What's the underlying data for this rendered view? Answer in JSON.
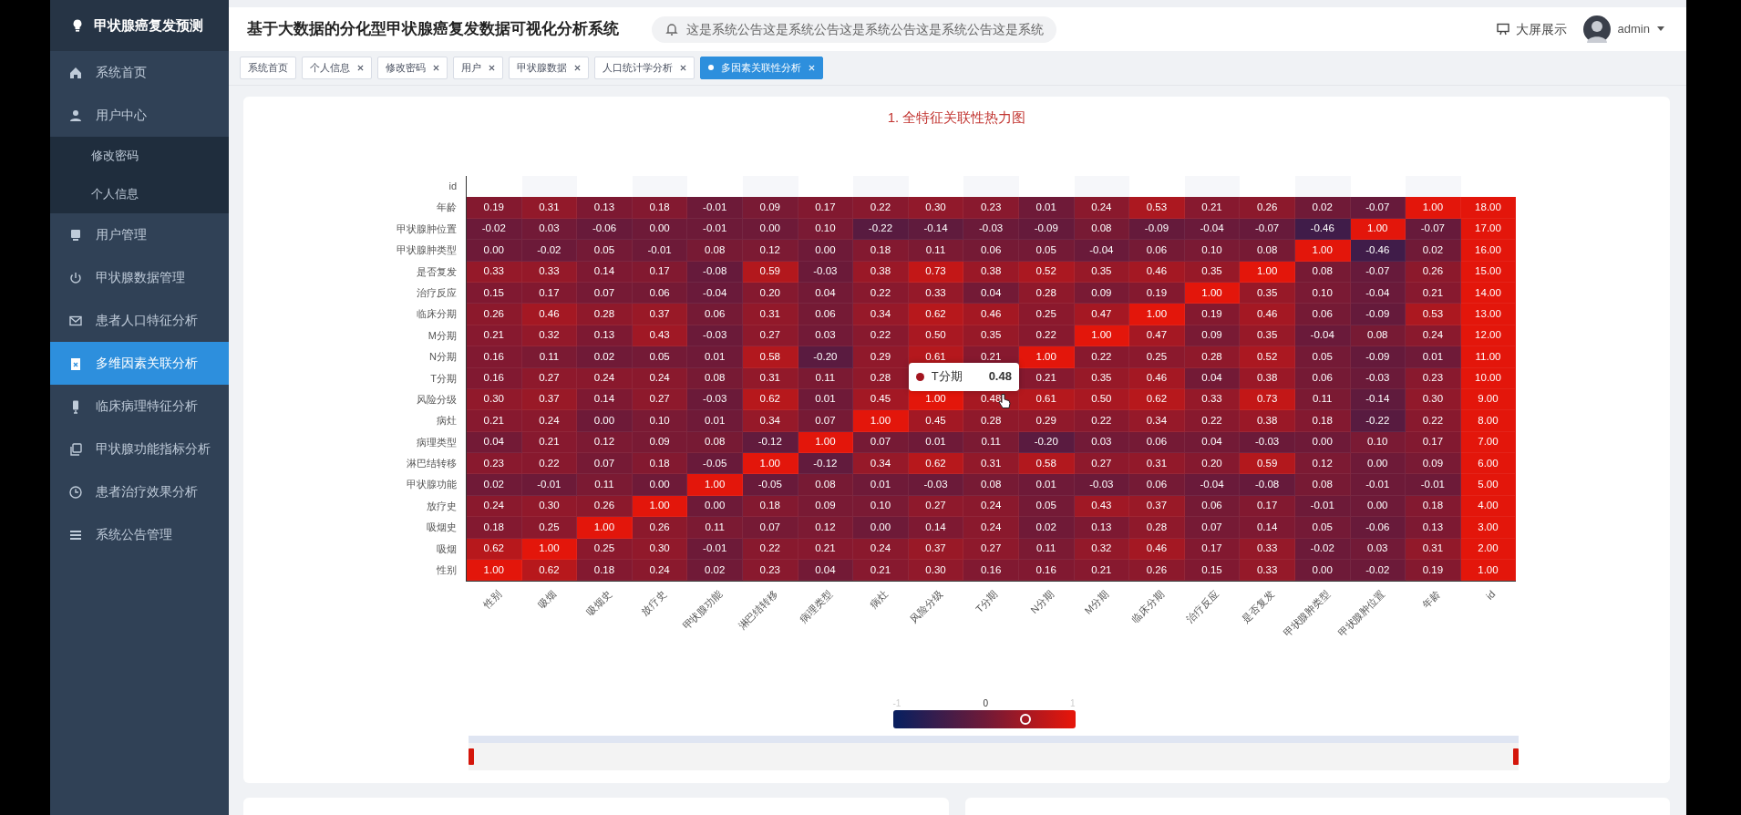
{
  "brand": {
    "title": "甲状腺癌复发预测"
  },
  "sidebar": {
    "items": [
      {
        "label": "系统首页",
        "selected": false
      },
      {
        "label": "用户中心",
        "selected": false,
        "expanded": true,
        "children": [
          {
            "label": "修改密码",
            "selected": false
          },
          {
            "label": "个人信息",
            "selected": false
          }
        ]
      },
      {
        "label": "用户管理",
        "selected": false
      },
      {
        "label": "甲状腺数据管理",
        "selected": false
      },
      {
        "label": "患者人口特征分析",
        "selected": false
      },
      {
        "label": "多维因素关联分析",
        "selected": true
      },
      {
        "label": "临床病理特征分析",
        "selected": false
      },
      {
        "label": "甲状腺功能指标分析",
        "selected": false
      },
      {
        "label": "患者治疗效果分析",
        "selected": false
      },
      {
        "label": "系统公告管理",
        "selected": false
      }
    ]
  },
  "header": {
    "title": "基于大数据的分化型甲状腺癌复发数据可视化分析系统",
    "notice": "这是系统公告这是系统公告这是系统公告这是系统公告这是系统",
    "big_screen": "大屏展示",
    "user": "admin"
  },
  "tabs": [
    {
      "label": "系统首页",
      "closable": false,
      "selected": false
    },
    {
      "label": "个人信息",
      "closable": true,
      "selected": false
    },
    {
      "label": "修改密码",
      "closable": true,
      "selected": false
    },
    {
      "label": "用户",
      "closable": true,
      "selected": false
    },
    {
      "label": "甲状腺数据",
      "closable": true,
      "selected": false
    },
    {
      "label": "人口统计学分析",
      "closable": true,
      "selected": false
    },
    {
      "label": "多因素关联性分析",
      "closable": true,
      "selected": true
    }
  ],
  "heatmap": {
    "title": "1. 全特征关联性热力图",
    "columns": [
      "性别",
      "吸烟",
      "吸烟史",
      "放疗史",
      "甲状腺功能",
      "淋巴结转移",
      "病理类型",
      "病灶",
      "风险分级",
      "T分期",
      "N分期",
      "M分期",
      "临床分期",
      "治疗反应",
      "是否复发",
      "甲状腺肿类型",
      "甲状腺肿位置",
      "年龄",
      "id"
    ],
    "rows": [
      {
        "label": "id"
      },
      {
        "label": "年龄",
        "cells": [
          "0.19",
          "0.31",
          "0.13",
          "0.18",
          "-0.01",
          "0.09",
          "0.17",
          "0.22",
          "0.30",
          "0.23",
          "0.01",
          "0.24",
          "0.53",
          "0.21",
          "0.26",
          "0.02",
          "-0.07",
          "1.00",
          "18.00"
        ]
      },
      {
        "label": "甲状腺肿位置",
        "cells": [
          "-0.02",
          "0.03",
          "-0.06",
          "0.00",
          "-0.01",
          "0.00",
          "0.10",
          "-0.22",
          "-0.14",
          "-0.03",
          "-0.09",
          "0.08",
          "-0.09",
          "-0.04",
          "-0.07",
          "-0.46",
          "1.00",
          "-0.07",
          "17.00"
        ]
      },
      {
        "label": "甲状腺肿类型",
        "cells": [
          "0.00",
          "-0.02",
          "0.05",
          "-0.01",
          "0.08",
          "0.12",
          "0.00",
          "0.18",
          "0.11",
          "0.06",
          "0.05",
          "-0.04",
          "0.06",
          "0.10",
          "0.08",
          "1.00",
          "-0.46",
          "0.02",
          "16.00"
        ]
      },
      {
        "label": "是否复发",
        "cells": [
          "0.33",
          "0.33",
          "0.14",
          "0.17",
          "-0.08",
          "0.59",
          "-0.03",
          "0.38",
          "0.73",
          "0.38",
          "0.52",
          "0.35",
          "0.46",
          "0.35",
          "1.00",
          "0.08",
          "-0.07",
          "0.26",
          "15.00"
        ]
      },
      {
        "label": "治疗反应",
        "cells": [
          "0.15",
          "0.17",
          "0.07",
          "0.06",
          "-0.04",
          "0.20",
          "0.04",
          "0.22",
          "0.33",
          "0.04",
          "0.28",
          "0.09",
          "0.19",
          "1.00",
          "0.35",
          "0.10",
          "-0.04",
          "0.21",
          "14.00"
        ]
      },
      {
        "label": "临床分期",
        "cells": [
          "0.26",
          "0.46",
          "0.28",
          "0.37",
          "0.06",
          "0.31",
          "0.06",
          "0.34",
          "0.62",
          "0.46",
          "0.25",
          "0.47",
          "1.00",
          "0.19",
          "0.46",
          "0.06",
          "-0.09",
          "0.53",
          "13.00"
        ]
      },
      {
        "label": "M分期",
        "cells": [
          "0.21",
          "0.32",
          "0.13",
          "0.43",
          "-0.03",
          "0.27",
          "0.03",
          "0.22",
          "0.50",
          "0.35",
          "0.22",
          "1.00",
          "0.47",
          "0.09",
          "0.35",
          "-0.04",
          "0.08",
          "0.24",
          "12.00"
        ]
      },
      {
        "label": "N分期",
        "cells": [
          "0.16",
          "0.11",
          "0.02",
          "0.05",
          "0.01",
          "0.58",
          "-0.20",
          "0.29",
          "0.61",
          "0.21",
          "1.00",
          "0.22",
          "0.25",
          "0.28",
          "0.52",
          "0.05",
          "-0.09",
          "0.01",
          "11.00"
        ]
      },
      {
        "label": "T分期",
        "cells": [
          "0.16",
          "0.27",
          "0.24",
          "0.24",
          "0.08",
          "0.31",
          "0.11",
          "0.28",
          null,
          null,
          "0.21",
          "0.35",
          "0.46",
          "0.04",
          "0.38",
          "0.06",
          "-0.03",
          "0.23",
          "10.00"
        ]
      },
      {
        "label": "风险分级",
        "cells": [
          "0.30",
          "0.37",
          "0.14",
          "0.27",
          "-0.03",
          "0.62",
          "0.01",
          "0.45",
          "1.00",
          "0.48",
          "0.61",
          "0.50",
          "0.62",
          "0.33",
          "0.73",
          "0.11",
          "-0.14",
          "0.30",
          "9.00"
        ]
      },
      {
        "label": "病灶",
        "cells": [
          "0.21",
          "0.24",
          "0.00",
          "0.10",
          "0.01",
          "0.34",
          "0.07",
          "1.00",
          "0.45",
          "0.28",
          "0.29",
          "0.22",
          "0.34",
          "0.22",
          "0.38",
          "0.18",
          "-0.22",
          "0.22",
          "8.00"
        ]
      },
      {
        "label": "病理类型",
        "cells": [
          "0.04",
          "0.21",
          "0.12",
          "0.09",
          "0.08",
          "-0.12",
          "1.00",
          "0.07",
          "0.01",
          "0.11",
          "-0.20",
          "0.03",
          "0.06",
          "0.04",
          "-0.03",
          "0.00",
          "0.10",
          "0.17",
          "7.00"
        ]
      },
      {
        "label": "淋巴结转移",
        "cells": [
          "0.23",
          "0.22",
          "0.07",
          "0.18",
          "-0.05",
          "1.00",
          "-0.12",
          "0.34",
          "0.62",
          "0.31",
          "0.58",
          "0.27",
          "0.31",
          "0.20",
          "0.59",
          "0.12",
          "0.00",
          "0.09",
          "6.00"
        ]
      },
      {
        "label": "甲状腺功能",
        "cells": [
          "0.02",
          "-0.01",
          "0.11",
          "0.00",
          "1.00",
          "-0.05",
          "0.08",
          "0.01",
          "-0.03",
          "0.08",
          "0.01",
          "-0.03",
          "0.06",
          "-0.04",
          "-0.08",
          "0.08",
          "-0.01",
          "-0.01",
          "5.00"
        ]
      },
      {
        "label": "放疗史",
        "cells": [
          "0.24",
          "0.30",
          "0.26",
          "1.00",
          "0.00",
          "0.18",
          "0.09",
          "0.10",
          "0.27",
          "0.24",
          "0.05",
          "0.43",
          "0.37",
          "0.06",
          "0.17",
          "-0.01",
          "0.00",
          "0.18",
          "4.00"
        ]
      },
      {
        "label": "吸烟史",
        "cells": [
          "0.18",
          "0.25",
          "1.00",
          "0.26",
          "0.11",
          "0.07",
          "0.12",
          "0.00",
          "0.14",
          "0.24",
          "0.02",
          "0.13",
          "0.28",
          "0.07",
          "0.14",
          "0.05",
          "-0.06",
          "0.13",
          "3.00"
        ]
      },
      {
        "label": "吸烟",
        "cells": [
          "0.62",
          "1.00",
          "0.25",
          "0.30",
          "-0.01",
          "0.22",
          "0.21",
          "0.24",
          "0.37",
          "0.27",
          "0.11",
          "0.32",
          "0.46",
          "0.17",
          "0.33",
          "-0.02",
          "0.03",
          "0.31",
          "2.00"
        ]
      },
      {
        "label": "性别",
        "cells": [
          "1.00",
          "0.62",
          "0.18",
          "0.24",
          "0.02",
          "0.23",
          "0.04",
          "0.21",
          "0.30",
          "0.16",
          "0.16",
          "0.21",
          "0.26",
          "0.15",
          "0.33",
          "0.00",
          "-0.02",
          "0.19",
          "1.00"
        ]
      }
    ],
    "tooltip": {
      "label": "T分期",
      "value": "0.48",
      "color": "#a3151f"
    },
    "visual_map": {
      "min_label": "-1",
      "mid_label": "0",
      "max_label": "1",
      "level": 0.74
    }
  }
}
